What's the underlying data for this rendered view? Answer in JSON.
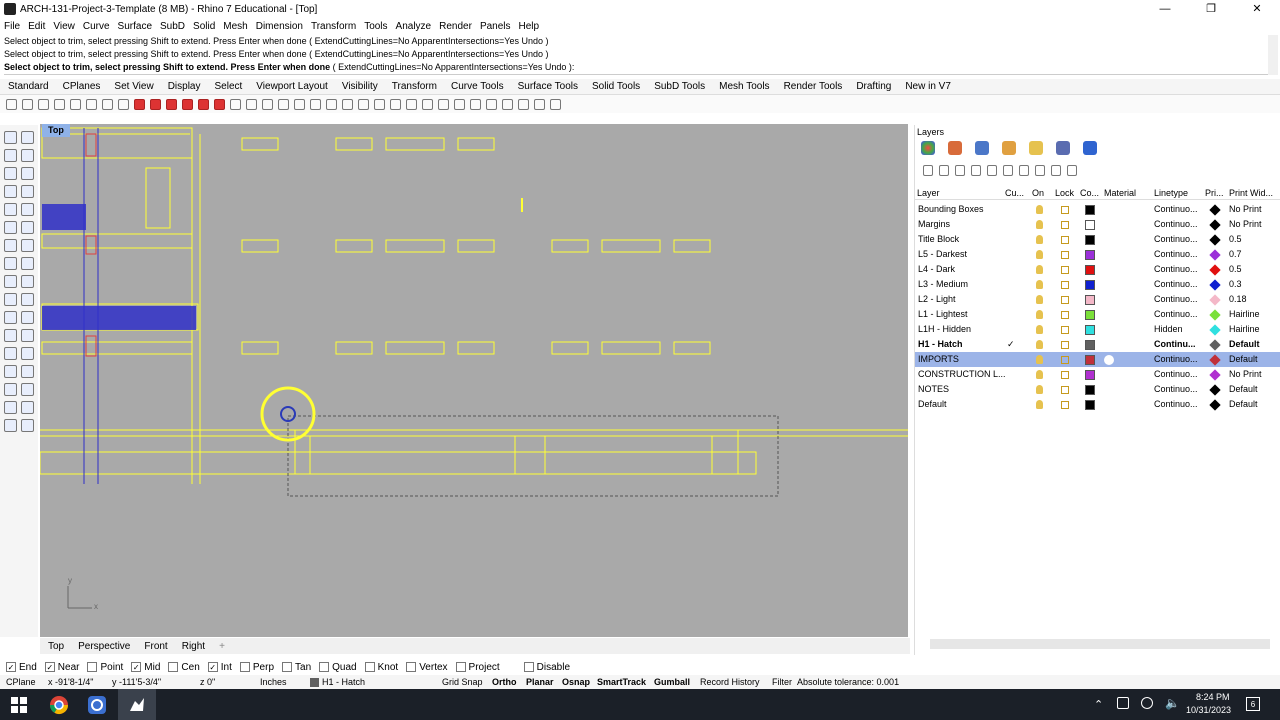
{
  "window": {
    "title": "ARCH-131-Project-3-Template (8 MB) - Rhino 7 Educational - [Top]",
    "controls": [
      "—",
      "❐",
      "✕"
    ]
  },
  "menu": [
    "File",
    "Edit",
    "View",
    "Curve",
    "Surface",
    "SubD",
    "Solid",
    "Mesh",
    "Dimension",
    "Transform",
    "Tools",
    "Analyze",
    "Render",
    "Panels",
    "Help"
  ],
  "command": {
    "history": [
      "Select object to trim, select pressing Shift to extend. Press Enter when done ( ExtendCuttingLines=No  ApparentIntersections=Yes  Undo )",
      "Select object to trim, select pressing Shift to extend. Press Enter when done ( ExtendCuttingLines=No  ApparentIntersections=Yes  Undo )"
    ],
    "prompt_bold": "Select object to trim, select pressing Shift to extend. Press Enter when done",
    "prompt_options": "( ExtendCuttingLines=No  ApparentIntersections=Yes  Undo ):"
  },
  "toolbar_tabs": [
    "Standard",
    "CPlanes",
    "Set View",
    "Display",
    "Select",
    "Viewport Layout",
    "Visibility",
    "Transform",
    "Curve Tools",
    "Surface Tools",
    "Solid Tools",
    "SubD Tools",
    "Mesh Tools",
    "Render Tools",
    "Drafting",
    "New in V7"
  ],
  "viewport": {
    "label": "Top",
    "axis_x": "x",
    "axis_y": "y"
  },
  "view_tabs": [
    "Top",
    "Perspective",
    "Front",
    "Right",
    "+"
  ],
  "osnaps": [
    {
      "label": "End",
      "checked": true
    },
    {
      "label": "Near",
      "checked": true
    },
    {
      "label": "Point",
      "checked": false
    },
    {
      "label": "Mid",
      "checked": true
    },
    {
      "label": "Cen",
      "checked": false
    },
    {
      "label": "Int",
      "checked": true
    },
    {
      "label": "Perp",
      "checked": false
    },
    {
      "label": "Tan",
      "checked": false
    },
    {
      "label": "Quad",
      "checked": false
    },
    {
      "label": "Knot",
      "checked": false
    },
    {
      "label": "Vertex",
      "checked": false
    },
    {
      "label": "Project",
      "checked": false
    },
    {
      "label": "Disable",
      "checked": false
    }
  ],
  "status": {
    "cplane": "CPlane",
    "x": "x -91'8-1/4\"",
    "y": "y -111'5-3/4\"",
    "z": "z 0\"",
    "units": "Inches",
    "layer": "H1 - Hatch",
    "grid_snap": "Grid Snap",
    "ortho": "Ortho",
    "planar": "Planar",
    "osnap": "Osnap",
    "smarttrack": "SmartTrack",
    "gumball": "Gumball",
    "record_history": "Record History",
    "filter": "Filter",
    "tolerance": "Absolute tolerance: 0.001"
  },
  "taskbar": {
    "time": "8:24 PM",
    "date": "10/31/2023",
    "notif": "6"
  },
  "layers_panel": {
    "title": "Layers",
    "columns": [
      "Layer",
      "Cu...",
      "On",
      "Lock",
      "Co...",
      "Material",
      "Linetype",
      "Pri...",
      "Print Wid..."
    ],
    "rows": [
      {
        "name": "Bounding Boxes",
        "color": "#000000",
        "linetype": "Continuo...",
        "print_width": "No Print",
        "current": false,
        "selected": false
      },
      {
        "name": "Margins",
        "color": "#ffffff",
        "linetype": "Continuo...",
        "print_width": "No Print",
        "current": false,
        "selected": false
      },
      {
        "name": "Title Block",
        "color": "#000000",
        "linetype": "Continuo...",
        "print_width": "0.5",
        "current": false,
        "selected": false
      },
      {
        "name": "L5 - Darkest",
        "color": "#9b30d9",
        "linetype": "Continuo...",
        "print_width": "0.7",
        "current": false,
        "selected": false
      },
      {
        "name": "L4 - Dark",
        "color": "#e01010",
        "linetype": "Continuo...",
        "print_width": "0.5",
        "current": false,
        "selected": false
      },
      {
        "name": "L3 - Medium",
        "color": "#1020d0",
        "linetype": "Continuo...",
        "print_width": "0.3",
        "current": false,
        "selected": false
      },
      {
        "name": "L2 - Light",
        "color": "#f4b8c8",
        "linetype": "Continuo...",
        "print_width": "0.18",
        "current": false,
        "selected": false
      },
      {
        "name": "L1 - Lightest",
        "color": "#7be03a",
        "linetype": "Continuo...",
        "print_width": "Hairline",
        "current": false,
        "selected": false
      },
      {
        "name": "L1H - Hidden",
        "color": "#30e0e0",
        "linetype": "Hidden",
        "print_width": "Hairline",
        "current": false,
        "selected": false
      },
      {
        "name": "H1 - Hatch",
        "color": "#606060",
        "linetype": "Continu...",
        "print_width": "Default",
        "current": true,
        "selected": false
      },
      {
        "name": "IMPORTS",
        "color": "#c0303a",
        "linetype": "Continuo...",
        "print_width": "Default",
        "current": false,
        "selected": true
      },
      {
        "name": "CONSTRUCTION L...",
        "color": "#b030d0",
        "linetype": "Continuo...",
        "print_width": "No Print",
        "current": false,
        "selected": false
      },
      {
        "name": "NOTES",
        "color": "#000000",
        "linetype": "Continuo...",
        "print_width": "Default",
        "current": false,
        "selected": false
      },
      {
        "name": "Default",
        "color": "#000000",
        "linetype": "Continuo...",
        "print_width": "Default",
        "current": false,
        "selected": false
      }
    ]
  },
  "colors": {
    "viewport_bg": "#a9a9a9",
    "geometry": "#ffff33",
    "accent": "#3c7fd6"
  }
}
